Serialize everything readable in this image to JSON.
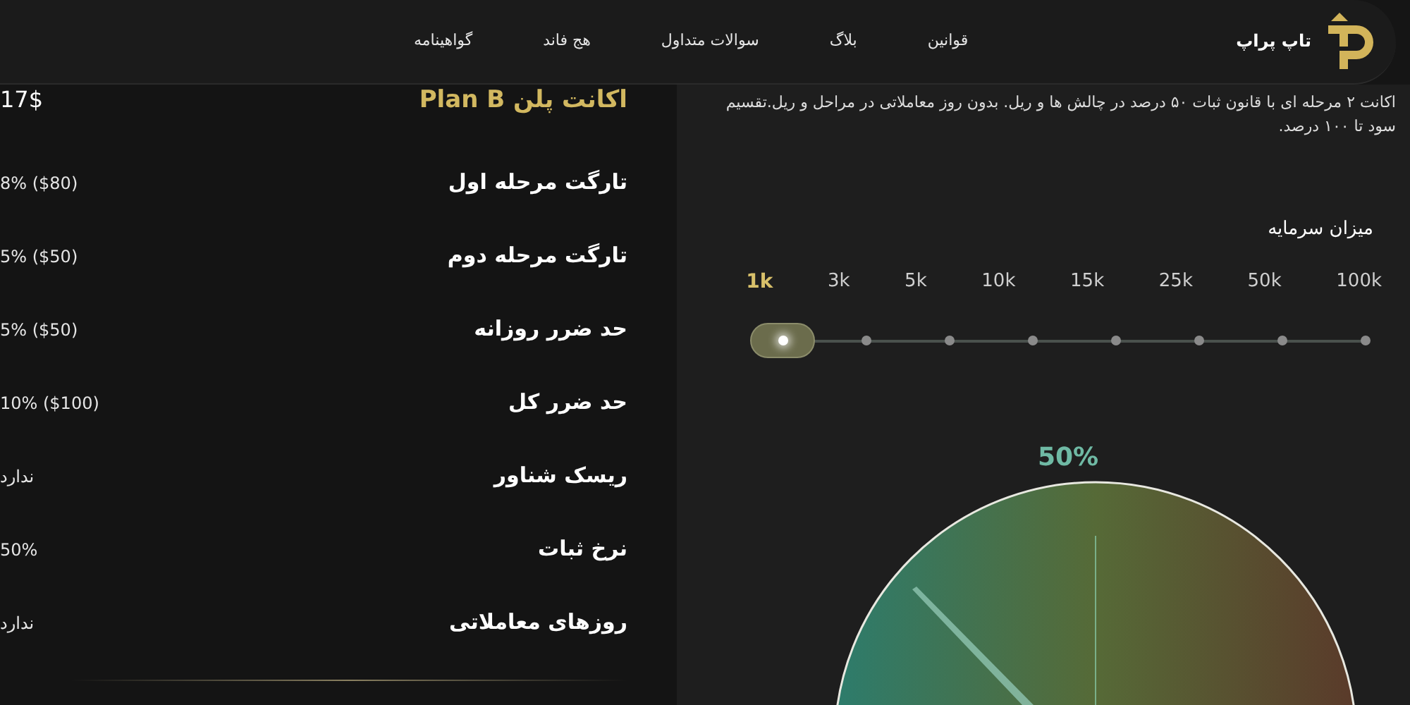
{
  "header": {
    "brand": "تاپ پراپ",
    "nav": [
      {
        "label": "قوانین"
      },
      {
        "label": "بلاگ"
      },
      {
        "label": "سوالات متداول"
      },
      {
        "label": "هج فاند"
      },
      {
        "label": "گواهینامه"
      }
    ]
  },
  "plan": {
    "title": "اکانت پلن Plan B",
    "price": "17$",
    "rows": [
      {
        "label": "تارگت مرحله اول",
        "value": "8% ($80)"
      },
      {
        "label": "تارگت مرحله دوم",
        "value": "5% ($50)"
      },
      {
        "label": "حد ضرر روزانه",
        "value": "5% ($50)"
      },
      {
        "label": "حد ضرر کل",
        "value": "10% ($100)"
      },
      {
        "label": "ریسک شناور",
        "value": "ندارد"
      },
      {
        "label": "نرخ ثبات",
        "value": "50%"
      },
      {
        "label": "روزهای معاملاتی",
        "value": "ندارد"
      }
    ]
  },
  "details": {
    "description": "اکانت ۲ مرحله ای با قانون ثبات ۵۰ درصد در چالش ها و ریل. بدون روز معاملاتی در مراحل و ریل.تقسیم سود تا ۱۰۰ درصد.",
    "capital_label": "میزان سرمایه",
    "capital_options": [
      {
        "label": "100k",
        "selected": false
      },
      {
        "label": "50k",
        "selected": false
      },
      {
        "label": "25k",
        "selected": false
      },
      {
        "label": "15k",
        "selected": false
      },
      {
        "label": "10k",
        "selected": false
      },
      {
        "label": "5k",
        "selected": false
      },
      {
        "label": "3k",
        "selected": false
      },
      {
        "label": "1k",
        "selected": true
      }
    ],
    "gauge": {
      "reading": "50%"
    }
  }
}
